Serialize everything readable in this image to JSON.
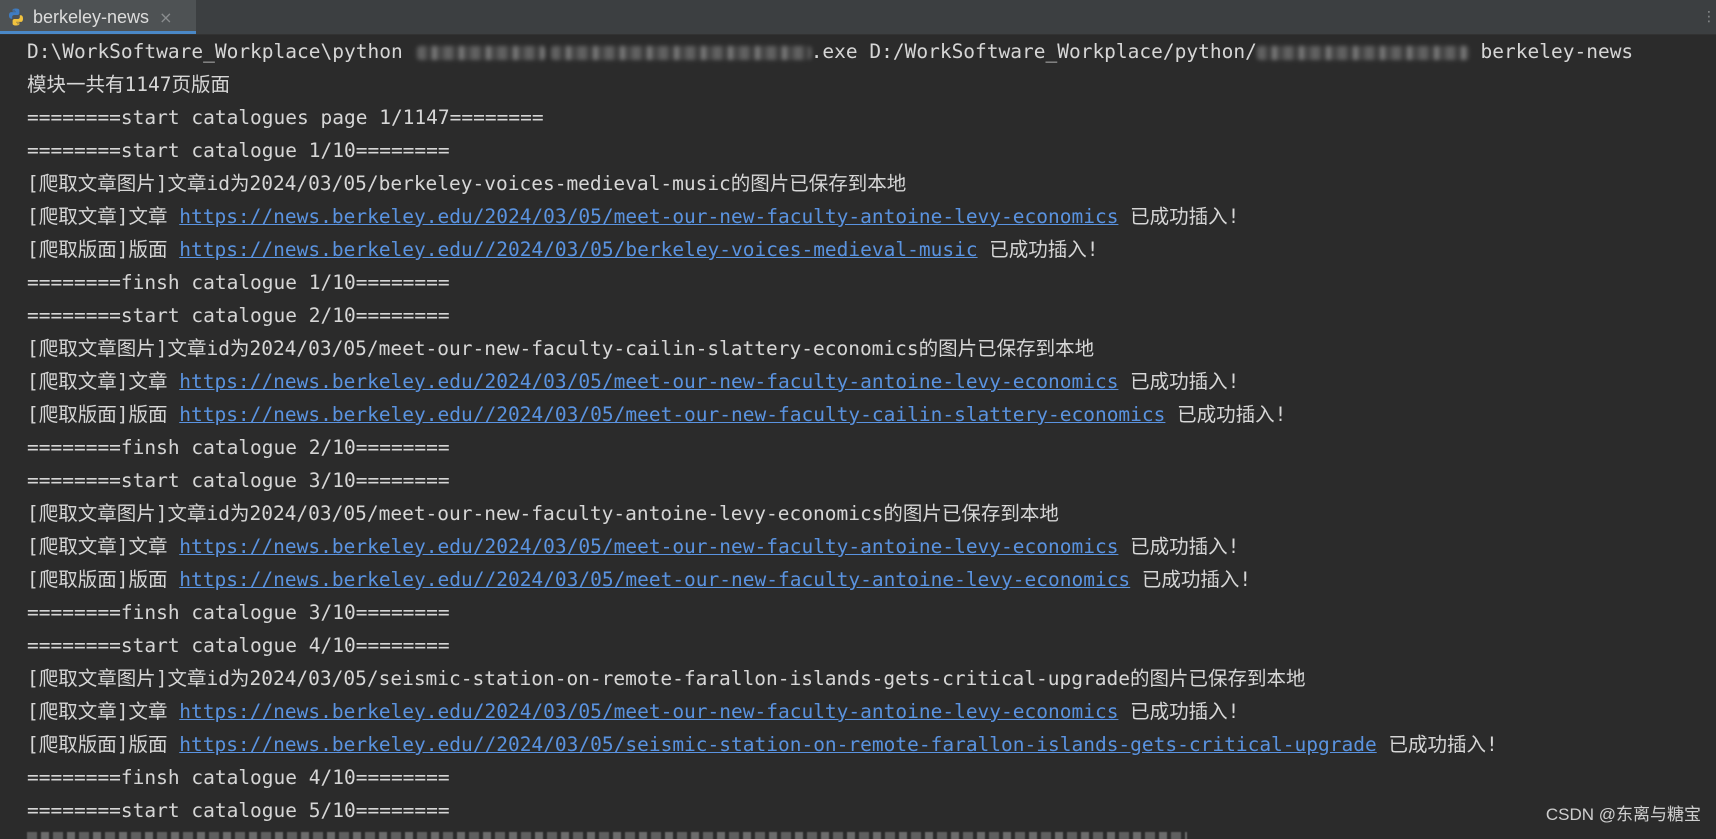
{
  "tab": {
    "title": "berkeley-news",
    "close_glyph": "×",
    "icon": "python-icon"
  },
  "console": {
    "command": {
      "prefix": "D:\\WorkSoftware_Workplace\\python",
      "middle": ".exe D:/WorkSoftware_Workplace/python/",
      "suffix": " berkeley-news"
    },
    "lines": [
      "模块一共有1147页版面",
      "========start catalogues page 1/1147========",
      "========start catalogue 1/10========",
      "[爬取文章图片]文章id为2024/03/05/berkeley-voices-medieval-music的图片已保存到本地",
      {
        "prefix": "[爬取文章]文章 ",
        "url": "https://news.berkeley.edu/2024/03/05/meet-our-new-faculty-antoine-levy-economics",
        "suffix": " 已成功插入!"
      },
      {
        "prefix": "[爬取版面]版面 ",
        "url": "https://news.berkeley.edu//2024/03/05/berkeley-voices-medieval-music",
        "suffix": " 已成功插入!"
      },
      "========finsh catalogue 1/10========",
      "========start catalogue 2/10========",
      "[爬取文章图片]文章id为2024/03/05/meet-our-new-faculty-cailin-slattery-economics的图片已保存到本地",
      {
        "prefix": "[爬取文章]文章 ",
        "url": "https://news.berkeley.edu/2024/03/05/meet-our-new-faculty-antoine-levy-economics",
        "suffix": " 已成功插入!"
      },
      {
        "prefix": "[爬取版面]版面 ",
        "url": "https://news.berkeley.edu//2024/03/05/meet-our-new-faculty-cailin-slattery-economics",
        "suffix": " 已成功插入!"
      },
      "========finsh catalogue 2/10========",
      "========start catalogue 3/10========",
      "[爬取文章图片]文章id为2024/03/05/meet-our-new-faculty-antoine-levy-economics的图片已保存到本地",
      {
        "prefix": "[爬取文章]文章 ",
        "url": "https://news.berkeley.edu/2024/03/05/meet-our-new-faculty-antoine-levy-economics",
        "suffix": " 已成功插入!"
      },
      {
        "prefix": "[爬取版面]版面 ",
        "url": "https://news.berkeley.edu//2024/03/05/meet-our-new-faculty-antoine-levy-economics",
        "suffix": " 已成功插入!"
      },
      "========finsh catalogue 3/10========",
      "========start catalogue 4/10========",
      "[爬取文章图片]文章id为2024/03/05/seismic-station-on-remote-farallon-islands-gets-critical-upgrade的图片已保存到本地",
      {
        "prefix": "[爬取文章]文章 ",
        "url": "https://news.berkeley.edu/2024/03/05/meet-our-new-faculty-antoine-levy-economics",
        "suffix": " 已成功插入!"
      },
      {
        "prefix": "[爬取版面]版面 ",
        "url": "https://news.berkeley.edu//2024/03/05/seismic-station-on-remote-farallon-islands-gets-critical-upgrade",
        "suffix": " 已成功插入!"
      },
      "========finsh catalogue 4/10========",
      "========start catalogue 5/10========"
    ]
  },
  "watermark": "CSDN @东离与糖宝",
  "colors": {
    "background": "#2b2b2b",
    "text": "#d6d6d6",
    "link": "#5a93e0",
    "tab_active": "#4e5254",
    "tab_accent": "#4a88c7"
  }
}
